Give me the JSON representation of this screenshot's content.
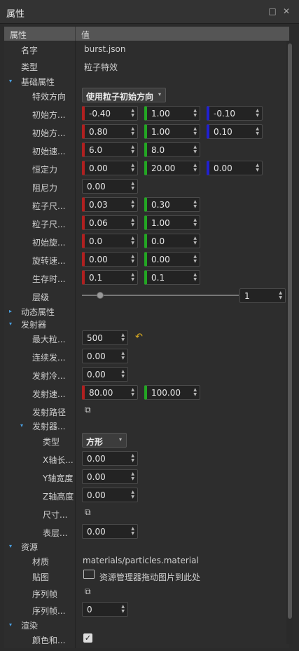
{
  "window": {
    "title": "属性",
    "restore_icon": "□",
    "close_icon": "✕"
  },
  "header": {
    "col_property": "属性",
    "col_value": "值"
  },
  "rows": {
    "name": {
      "label": "名字",
      "value": "burst.json"
    },
    "type": {
      "label": "类型",
      "value": "粒子特效"
    },
    "basic": {
      "label": "基础属性"
    },
    "effect_dir": {
      "label": "特效方向",
      "value": "使用粒子初始方向"
    },
    "init_dir1": {
      "label": "初始方...",
      "x": "-0.40",
      "y": "1.00",
      "z": "-0.10"
    },
    "init_dir2": {
      "label": "初始方...",
      "x": "0.80",
      "y": "1.00",
      "z": "0.10"
    },
    "init_speed": {
      "label": "初始速...",
      "x": "6.0",
      "y": "8.0"
    },
    "const_force": {
      "label": "恒定力",
      "x": "0.00",
      "y": "20.00",
      "z": "0.00"
    },
    "damping": {
      "label": "阻尼力",
      "x": "0.00"
    },
    "size1": {
      "label": "粒子尺...",
      "x": "0.03",
      "y": "0.30"
    },
    "size2": {
      "label": "粒子尺...",
      "x": "0.06",
      "y": "1.00"
    },
    "init_rot": {
      "label": "初始旋...",
      "x": "0.0",
      "y": "0.0"
    },
    "rot_speed": {
      "label": "旋转速...",
      "x": "0.00",
      "y": "0.00"
    },
    "lifetime": {
      "label": "生存时...",
      "x": "0.1",
      "y": "0.1"
    },
    "layer": {
      "label": "层级",
      "value": "1",
      "slider_fraction": 0.1
    },
    "dynamic": {
      "label": "动态属性"
    },
    "emitter": {
      "label": "发射器"
    },
    "max_particles": {
      "label": "最大粒...",
      "x": "500"
    },
    "continuous": {
      "label": "连续发...",
      "x": "0.00"
    },
    "cooldown": {
      "label": "发射冷...",
      "x": "0.00"
    },
    "emit_speed": {
      "label": "发射速...",
      "x": "80.00",
      "y": "100.00"
    },
    "emit_path": {
      "label": "发射路径"
    },
    "emitter_shape": {
      "label": "发射器..."
    },
    "shape_type": {
      "label": "类型",
      "value": "方形"
    },
    "x_len": {
      "label": "X轴长...",
      "x": "0.00"
    },
    "y_width": {
      "label": "Y轴宽度",
      "x": "0.00"
    },
    "z_height": {
      "label": "Z轴高度",
      "x": "0.00"
    },
    "size_obj": {
      "label": "尺寸..."
    },
    "surface": {
      "label": "表层...",
      "x": "0.00"
    },
    "resources": {
      "label": "资源"
    },
    "material": {
      "label": "材质",
      "value": "materials/particles.material"
    },
    "texture": {
      "label": "贴图",
      "value": "资源管理器拖动图片到此处"
    },
    "frames": {
      "label": "序列帧"
    },
    "frame_n": {
      "label": "序列帧...",
      "x": "0"
    },
    "render": {
      "label": "渲染"
    },
    "color_blend": {
      "label": "颜色和..."
    }
  },
  "icons": {
    "expand": "▾",
    "collapse": "▸",
    "spin": "▲▼",
    "combo": "▾",
    "file": "folder-link-icon",
    "undo": "↶",
    "check": "✓",
    "image": "image-icon"
  },
  "colors": {
    "x_axis": "#b02020",
    "y_axis": "#23a623",
    "z_axis": "#2020d0",
    "accent": "#4a9fe0"
  }
}
